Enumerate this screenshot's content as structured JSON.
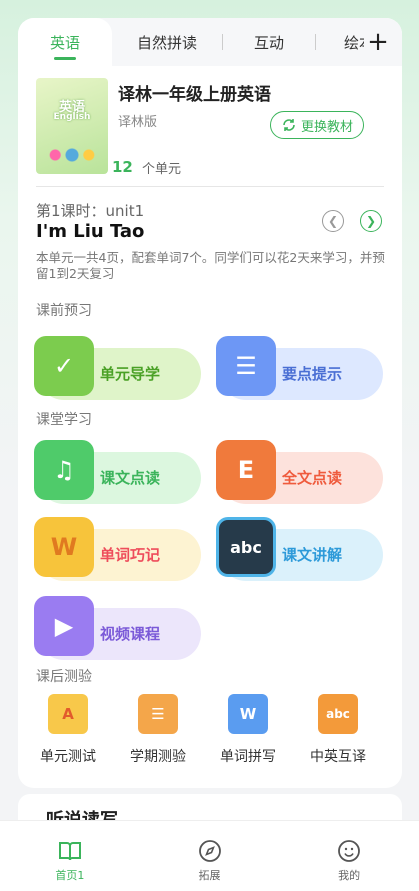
{
  "tabs": {
    "items": [
      "英语",
      "自然拼读",
      "互动",
      "绘本"
    ],
    "active_index": 0
  },
  "book": {
    "cover_title": "英语",
    "cover_subtitle": "English",
    "title": "译林一年级上册英语",
    "edition": "译林版",
    "switch_label": "更换教材",
    "unit_count": "12",
    "unit_label": "个单元"
  },
  "lesson": {
    "number_label": "第1课时：unit1",
    "title": "I'm Liu Tao",
    "description": "本单元一共4页，配套单词7个。同学们可以花2天来学习，并预留1到2天复习"
  },
  "sections": {
    "preview": "课前预习",
    "classroom": "课堂学习",
    "after_class": "课后测验"
  },
  "preview_items": [
    {
      "label": "单元导学",
      "icon": "checkmark-book-icon"
    },
    {
      "label": "要点提示",
      "icon": "list-icon"
    }
  ],
  "classroom_items": [
    {
      "label": "课文点读",
      "icon": "music-book-icon"
    },
    {
      "label": "全文点读",
      "icon": "e-book-icon"
    },
    {
      "label": "单词巧记",
      "icon": "w-card-icon"
    },
    {
      "label": "课文讲解",
      "icon": "abc-board-icon"
    },
    {
      "label": "视频课程",
      "icon": "video-camera-icon"
    }
  ],
  "test_items": [
    {
      "label": "单元测试",
      "icon": "a-paper-icon"
    },
    {
      "label": "学期测验",
      "icon": "doc-pencil-icon"
    },
    {
      "label": "单词拼写",
      "icon": "w-pen-icon"
    },
    {
      "label": "中英互译",
      "icon": "abc-card-icon"
    }
  ],
  "next_section_title": "听说读写",
  "bottom_nav": [
    {
      "label": "首页1",
      "icon": "book-open-icon",
      "active": true
    },
    {
      "label": "拓展",
      "icon": "compass-icon",
      "active": false
    },
    {
      "label": "我的",
      "icon": "smiley-icon",
      "active": false
    }
  ],
  "colors": {
    "brand_green": "#3bb45b",
    "preview_bg": "#dff4c9",
    "classroom_green_bg": "#dcf7df",
    "classroom_orange_bg": "#fde2dc",
    "classroom_yellow_bg": "#fdf3d2",
    "classroom_blue_bg": "#dbf1fb",
    "video_bg": "#ece6fb"
  }
}
